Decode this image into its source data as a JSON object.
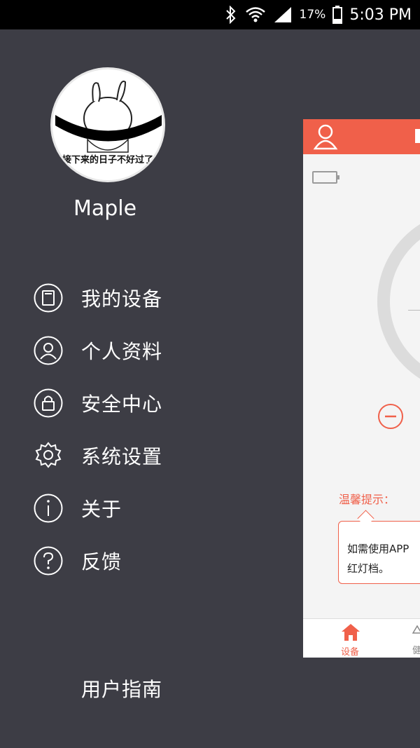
{
  "status_bar": {
    "battery_percent": "17%",
    "time": "5:03 PM"
  },
  "profile": {
    "avatar_caption": "接下来的日子不好过了",
    "username": "Maple"
  },
  "menu": [
    {
      "label": "我的设备",
      "icon": "device-icon"
    },
    {
      "label": "个人资料",
      "icon": "profile-icon"
    },
    {
      "label": "安全中心",
      "icon": "lock-icon"
    },
    {
      "label": "系统设置",
      "icon": "gear-icon"
    },
    {
      "label": "关于",
      "icon": "info-icon"
    },
    {
      "label": "反馈",
      "icon": "help-icon"
    }
  ],
  "footer": {
    "user_guide": "用户指南"
  },
  "panel": {
    "tip_title": "温馨提示：",
    "tip_line1": "如需使用APP",
    "tip_line2": "红灯档。",
    "tab_home": "设备",
    "tab_second": "健"
  },
  "colors": {
    "accent": "#f0604a",
    "drawer_bg": "#3d3d45"
  }
}
